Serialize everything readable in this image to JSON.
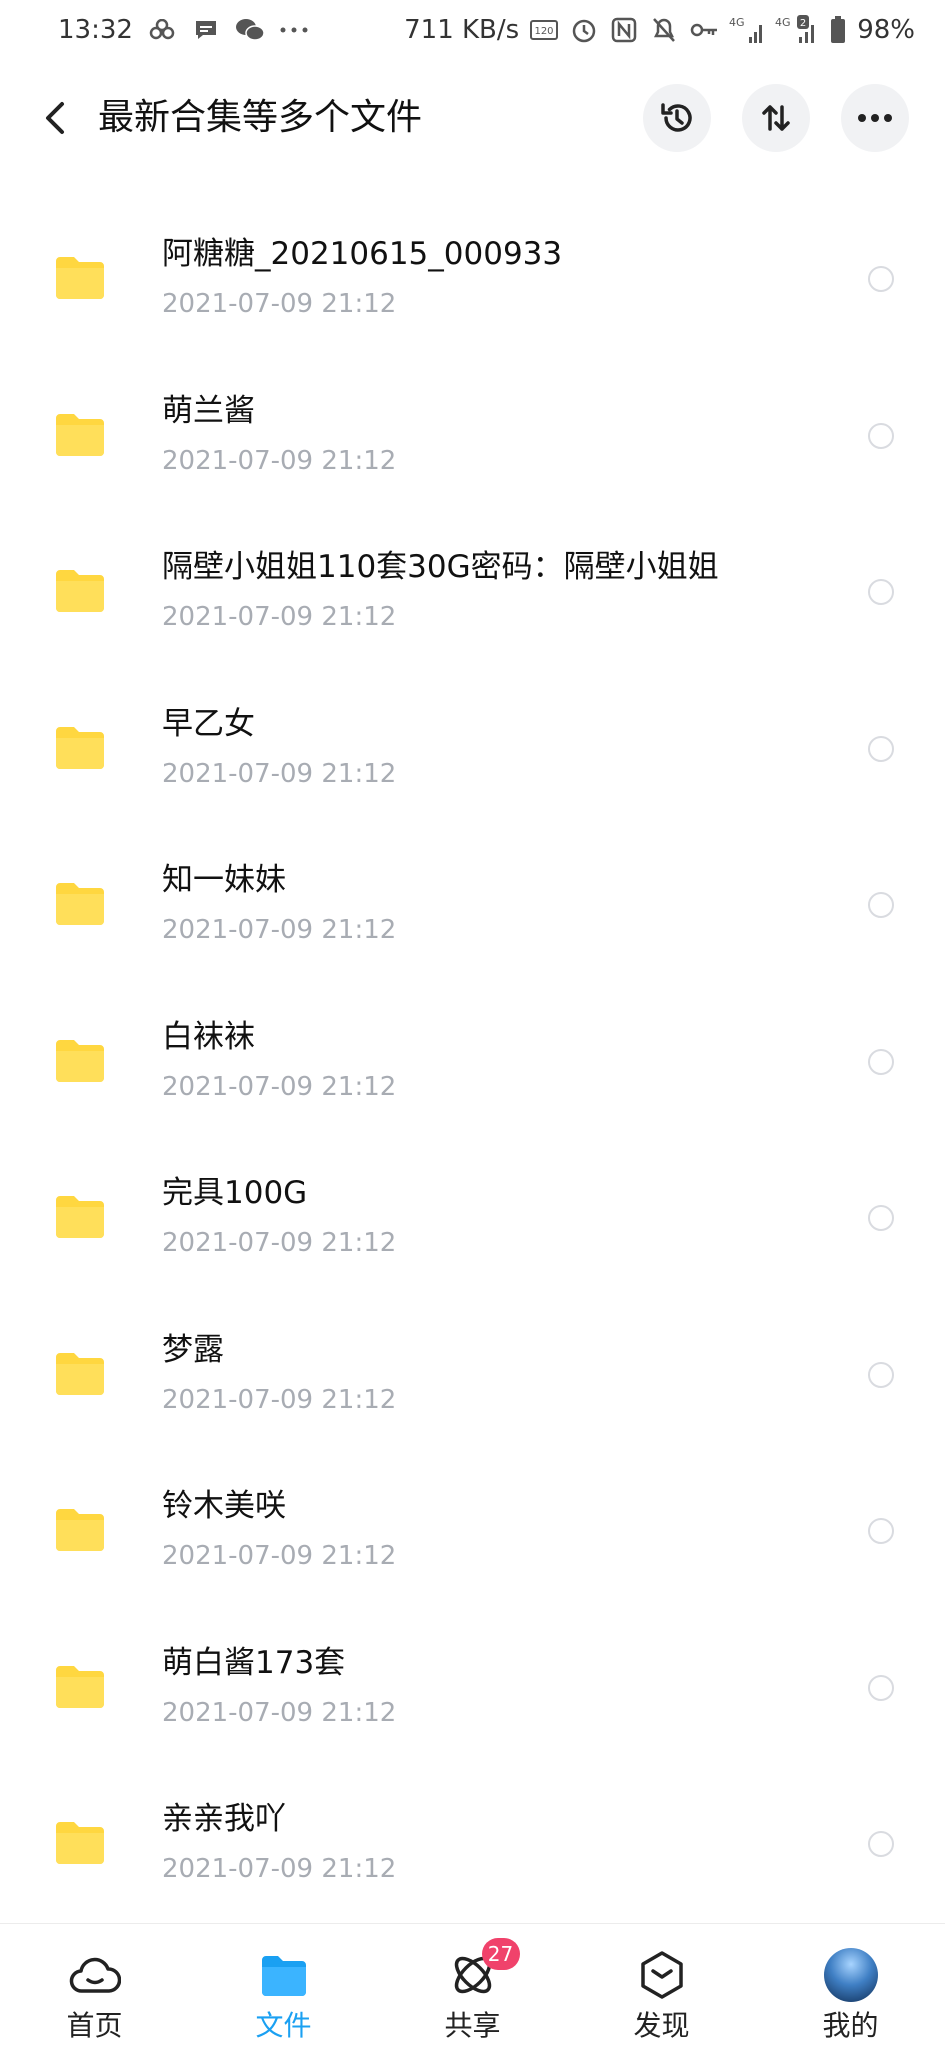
{
  "status_bar": {
    "time": "13:32",
    "speed": "711 KB/s",
    "battery": "98%",
    "signal1_label": "4G",
    "signal2_label": "4G",
    "sim2_badge": "2",
    "icons": [
      "cluster-icon",
      "message-icon",
      "wechat-icon",
      "more-dots-icon",
      "hz-icon",
      "alarm-icon",
      "nfc-icon",
      "mute-icon",
      "key-icon",
      "signal-icon",
      "signal-icon",
      "battery-icon"
    ]
  },
  "header": {
    "title": "最新合集等多个文件",
    "back_icon": "chevron-left-icon",
    "history_icon": "history-icon",
    "sort_icon": "sort-icon",
    "more_icon": "more-icon"
  },
  "files": [
    {
      "name": "阿糖糖_20210615_000933",
      "date": "2021-07-09  21:12"
    },
    {
      "name": "萌兰酱",
      "date": "2021-07-09  21:12"
    },
    {
      "name": "隔壁小姐姐110套30G密码：隔壁小姐姐",
      "date": "2021-07-09  21:12"
    },
    {
      "name": "早乙女",
      "date": "2021-07-09  21:12"
    },
    {
      "name": "知一妹妹",
      "date": "2021-07-09  21:12"
    },
    {
      "name": "白袜袜",
      "date": "2021-07-09  21:12"
    },
    {
      "name": "完具100G",
      "date": "2021-07-09  21:12"
    },
    {
      "name": "梦露",
      "date": "2021-07-09  21:12"
    },
    {
      "name": "铃木美咲",
      "date": "2021-07-09  21:12"
    },
    {
      "name": "萌白酱173套",
      "date": "2021-07-09  21:12"
    },
    {
      "name": "亲亲我吖",
      "date": "2021-07-09  21:12"
    }
  ],
  "bottom_nav": {
    "home": "首页",
    "files": "文件",
    "share": "共享",
    "share_badge": "27",
    "discover": "发现",
    "mine": "我的",
    "active": "files"
  },
  "colors": {
    "folder": "#ffd740",
    "accent": "#1aa0f2",
    "badge": "#f0426b",
    "date_text": "#a8acb3"
  }
}
